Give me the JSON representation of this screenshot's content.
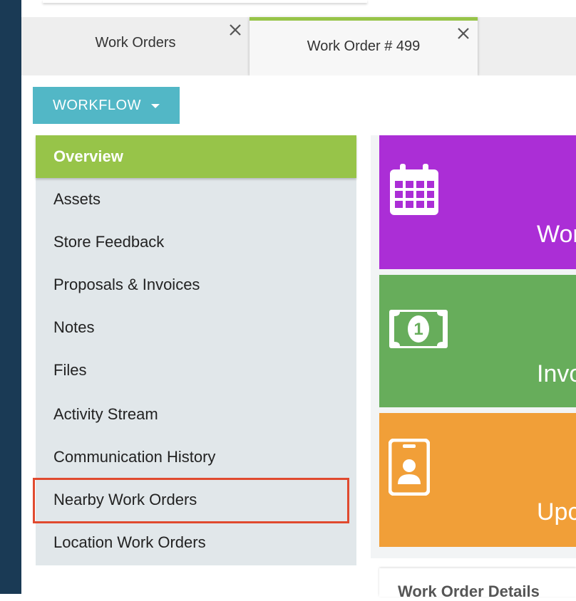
{
  "tabs": [
    {
      "label": "Work Orders",
      "active": false
    },
    {
      "label": "Work Order # 499",
      "active": true
    }
  ],
  "workflow_button": {
    "label": "WORKFLOW"
  },
  "sidebar": {
    "items": [
      {
        "label": "Overview",
        "active": true
      },
      {
        "label": "Assets"
      },
      {
        "label": "Store Feedback"
      },
      {
        "label": "Proposals & Invoices"
      },
      {
        "label": "Notes"
      },
      {
        "label": "Files"
      },
      {
        "label": "Activity Stream"
      },
      {
        "label": "Communication History"
      },
      {
        "label": "Nearby Work Orders",
        "highlighted": true
      },
      {
        "label": "Location Work Orders"
      }
    ]
  },
  "tiles": [
    {
      "label": "Wor",
      "icon": "calendar-icon",
      "color": "#ab2ed6"
    },
    {
      "label": "Invo",
      "icon": "money-bill-icon",
      "color": "#67ad5b"
    },
    {
      "label": "Upco",
      "icon": "id-badge-icon",
      "color": "#f19f38"
    }
  ],
  "details_card": {
    "title": "Work Order Details"
  },
  "colors": {
    "rail": "#1a3a55",
    "accent_green": "#97c449",
    "workflow_teal": "#52b7c6",
    "highlight_red": "#e04a2f"
  }
}
